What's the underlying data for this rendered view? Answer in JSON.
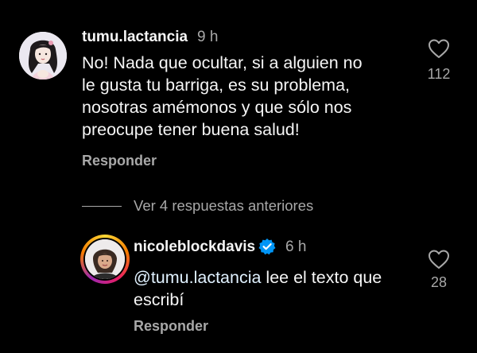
{
  "comments": [
    {
      "username": "tumu.lactancia",
      "time": "9 h",
      "text": "No! Nada que ocultar, si a alguien no le gusta tu barriga, es su problema, nosotras amémonos y que sólo nos preocupe tener buena salud!",
      "text_lines": [
        "No! Nada que ocultar, si a alguien no",
        "le gusta tu barriga, es su problema,",
        "nosotras amémonos y que sólo nos",
        "preocupe tener buena salud!"
      ],
      "likes": "112",
      "reply_label": "Responder",
      "avatar_icon": "illustrated-woman-avatar"
    },
    {
      "username": "nicoleblockdavis",
      "verified": true,
      "time": "6 h",
      "mention": "@tumu.lactancia",
      "text_after_mention": " lee el texto que",
      "text_line2": "escribí",
      "likes": "28",
      "reply_label": "Responder",
      "avatar_icon": "profile-photo-avatar"
    }
  ],
  "view_replies_label": "Ver 4 respuestas anteriores",
  "colors": {
    "background": "#000000",
    "primary_text": "#f5f5f5",
    "secondary_text": "#a8a8a8",
    "verified_blue": "#0095f6",
    "mention": "#e0f1ff"
  }
}
